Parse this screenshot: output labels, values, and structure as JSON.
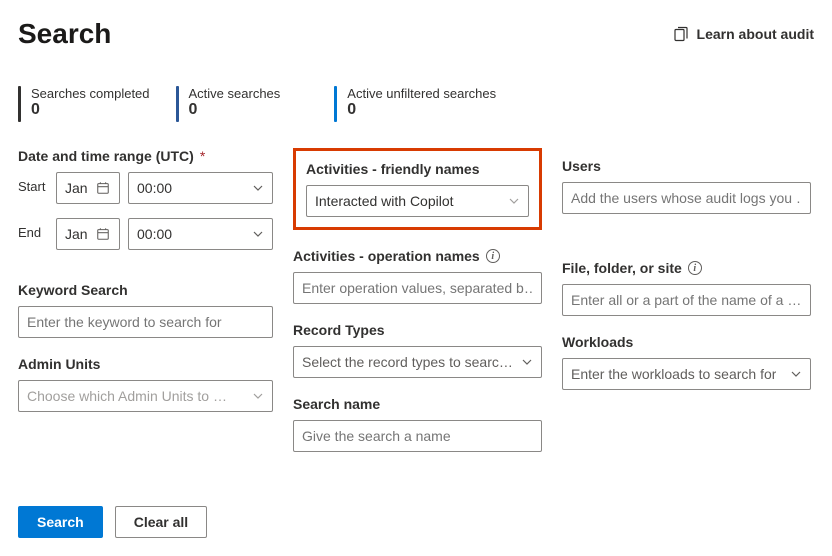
{
  "header": {
    "title": "Search",
    "learn_link": "Learn about audit"
  },
  "stats": [
    {
      "label": "Searches completed",
      "value": "0",
      "color": "#323130"
    },
    {
      "label": "Active searches",
      "value": "0",
      "color": "#2b5797"
    },
    {
      "label": "Active unfiltered searches",
      "value": "0",
      "color": "#0078d4"
    }
  ],
  "left": {
    "date_range_label": "Date and time range (UTC)",
    "start_label": "Start",
    "end_label": "End",
    "month": "Jan",
    "time": "00:00",
    "keyword_label": "Keyword Search",
    "keyword_placeholder": "Enter the keyword to search for",
    "admin_label": "Admin Units",
    "admin_placeholder": "Choose which Admin Units to …"
  },
  "mid": {
    "activities_friendly_label": "Activities - friendly names",
    "activities_friendly_value": "Interacted with Copilot",
    "activities_op_label": "Activities - operation names",
    "activities_op_placeholder": "Enter operation values, separated b…",
    "record_types_label": "Record Types",
    "record_types_placeholder": "Select the record types to searc…",
    "search_name_label": "Search name",
    "search_name_placeholder": "Give the search a name"
  },
  "right": {
    "users_label": "Users",
    "users_placeholder": "Add the users whose audit logs you …",
    "ffs_label": "File, folder, or site",
    "ffs_placeholder": "Enter all or a part of the name of a …",
    "workloads_label": "Workloads",
    "workloads_placeholder": "Enter the workloads to search for"
  },
  "buttons": {
    "search": "Search",
    "clear": "Clear all"
  },
  "icons": {
    "info": "i"
  }
}
